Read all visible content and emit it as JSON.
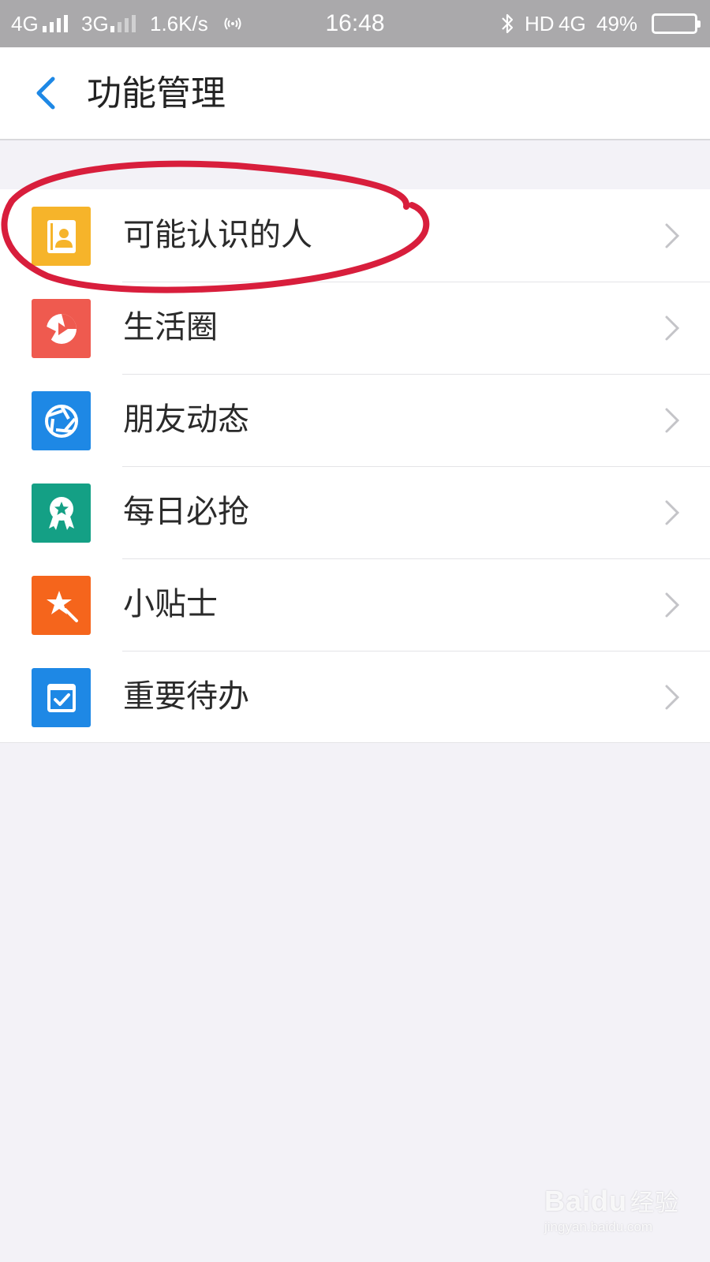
{
  "status_bar": {
    "network_1": "4G",
    "network_2": "3G",
    "speed": "1.6K/s",
    "hotspot_icon": "hotspot-icon",
    "time": "16:48",
    "bluetooth_icon": "bluetooth-icon",
    "hd": "HD",
    "network_3": "4G",
    "battery_percent": "49%",
    "battery_level": 0.49
  },
  "header": {
    "back_icon": "chevron-left-icon",
    "title": "功能管理",
    "accent_color": "#1e88e5"
  },
  "list": {
    "items": [
      {
        "label": "可能认识的人",
        "icon": "contact-card-icon",
        "icon_color": "#f6b42a",
        "chevron": "chevron-right-icon"
      },
      {
        "label": "生活圈",
        "icon": "life-circle-icon",
        "icon_color": "#ef5a4f",
        "chevron": "chevron-right-icon"
      },
      {
        "label": "朋友动态",
        "icon": "aperture-icon",
        "icon_color": "#1e88e5",
        "chevron": "chevron-right-icon"
      },
      {
        "label": "每日必抢",
        "icon": "badge-star-icon",
        "icon_color": "#14a085",
        "chevron": "chevron-right-icon"
      },
      {
        "label": "小贴士",
        "icon": "magic-wand-icon",
        "icon_color": "#f5651c",
        "chevron": "chevron-right-icon"
      },
      {
        "label": "重要待办",
        "icon": "todo-check-icon",
        "icon_color": "#1e88e5",
        "chevron": "chevron-right-icon"
      }
    ]
  },
  "annotation": {
    "color": "#d81e3c"
  },
  "watermark": {
    "logo_text": "Bai",
    "logo_text_2": "du",
    "logo_cn": "经验",
    "url": "jingyan.baidu.com"
  }
}
